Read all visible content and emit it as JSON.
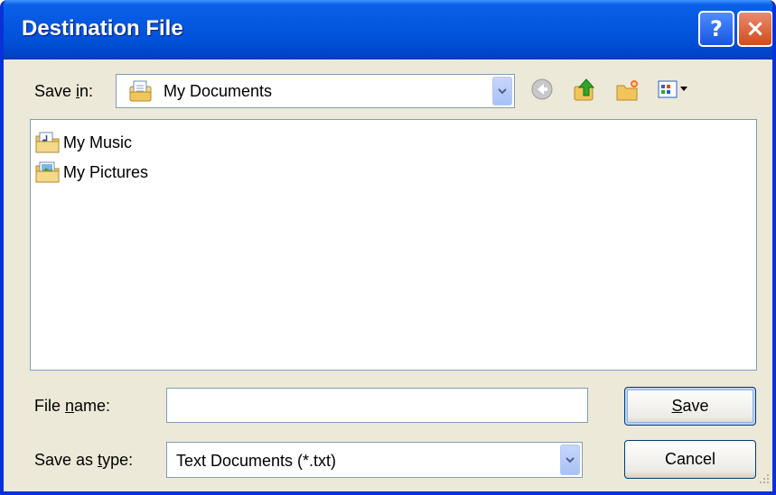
{
  "window": {
    "title": "Destination File",
    "help_label": "?",
    "close_label": "×"
  },
  "save_in": {
    "label_prefix": "Save ",
    "label_hotkey": "i",
    "label_suffix": "n:",
    "selected": "My Documents",
    "icon": "my-documents-icon"
  },
  "toolbar": {
    "icons": [
      "back-arrow-icon",
      "up-one-level-icon",
      "create-new-folder-icon",
      "view-menu-icon"
    ]
  },
  "files": [
    {
      "name": "My Music",
      "icon": "music-folder-icon"
    },
    {
      "name": "My Pictures",
      "icon": "pictures-folder-icon"
    }
  ],
  "file_name": {
    "label_prefix": "File ",
    "label_hotkey": "n",
    "label_suffix": "ame:",
    "value": ""
  },
  "save_as_type": {
    "label_prefix": "Save as ",
    "label_hotkey": "t",
    "label_suffix": "ype:",
    "selected": "Text Documents (*.txt)"
  },
  "buttons": {
    "save_hotkey": "S",
    "save_rest": "ave",
    "cancel": "Cancel"
  },
  "colors": {
    "titlebar": "#0458e0",
    "dialog_bg": "#ece9d8",
    "border": "#0831d9",
    "close_button": "#d24c1c"
  }
}
